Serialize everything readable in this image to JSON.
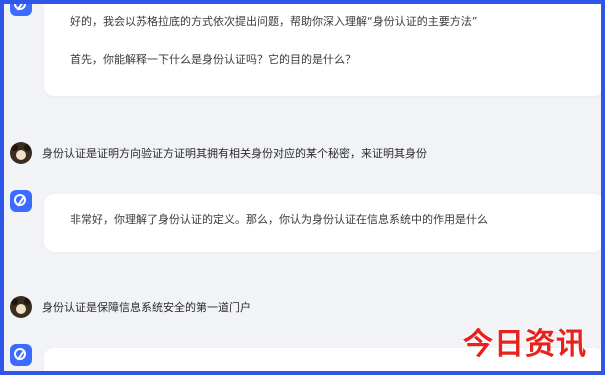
{
  "chat": {
    "messages": [
      {
        "role": "assistant",
        "paragraphs": [
          "好的，我会以苏格拉底的方式依次提出问题，帮助你深入理解“身份认证的主要方法”",
          "首先，你能解释一下什么是身份认证吗？它的目的是什么？"
        ]
      },
      {
        "role": "user",
        "text": "身份认证是证明方向验证方证明其拥有相关身份对应的某个秘密，来证明其身份"
      },
      {
        "role": "assistant",
        "paragraphs": [
          "非常好，你理解了身份认证的定义。那么，你认为身份认证在信息系统中的作用是什么"
        ]
      },
      {
        "role": "user",
        "text": "身份认证是保障信息系统安全的第一道门户"
      }
    ]
  },
  "watermark": {
    "text": "今日资讯"
  },
  "colors": {
    "border": "#2f56e8",
    "background": "#f1f3f6",
    "ai_avatar": "#3b6cff",
    "watermark": "#e8211c"
  }
}
